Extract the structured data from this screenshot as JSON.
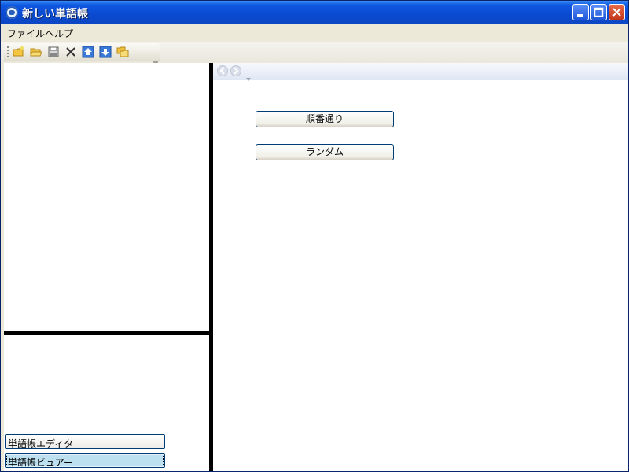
{
  "window": {
    "title": "新しい単語帳"
  },
  "menu": {
    "items": [
      "ファイル",
      "ヘルプ"
    ]
  },
  "toolbar": {
    "icons": [
      "new-folder-icon",
      "open-folder-icon",
      "save-icon",
      "delete-icon",
      "move-up-icon",
      "move-down-icon",
      "copy-folder-icon"
    ]
  },
  "left_panel": {
    "editor_button": "単語帳エディタ",
    "viewer_button": "単語帳ビュアー"
  },
  "right_panel": {
    "sequential_button": "順番通り",
    "random_button": "ランダム"
  },
  "colors": {
    "titlebar": "#0a4ad0",
    "selected": "#bde0f0",
    "splitter": "#000000"
  }
}
